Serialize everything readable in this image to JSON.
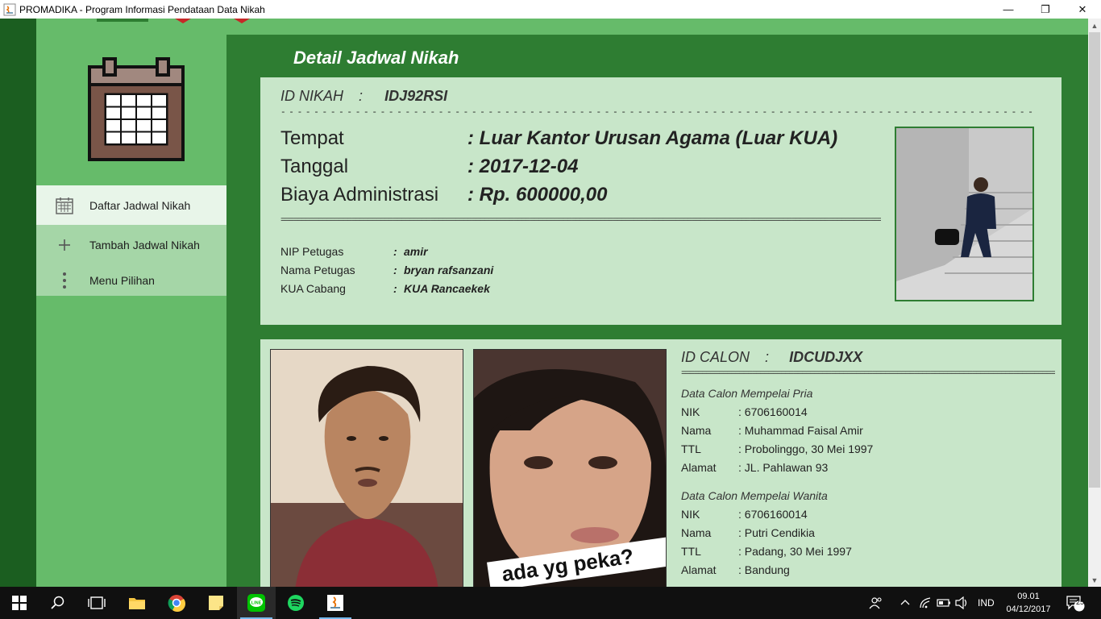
{
  "window": {
    "title": "PROMADIKA - Program Informasi Pendataan Data Nikah",
    "minimize": "—",
    "maximize": "❐",
    "close": "✕"
  },
  "sidebar": {
    "items": [
      {
        "label": "Daftar Jadwal Nikah",
        "icon": "calendar-icon",
        "active": true
      },
      {
        "label": "Tambah Jadwal Nikah",
        "icon": "plus-icon",
        "active": false
      },
      {
        "label": "Menu Pilihan",
        "icon": "more-vertical-icon",
        "active": false
      }
    ]
  },
  "main": {
    "title": "Detail Jadwal Nikah",
    "nikah": {
      "id_label": "ID NIKAH",
      "sep": ":",
      "id_value": "IDJ92RSI",
      "tempat_label": "Tempat",
      "tempat_value": ": Luar Kantor Urusan Agama (Luar KUA)",
      "tanggal_label": "Tanggal",
      "tanggal_value": ": 2017-12-04",
      "biaya_label": "Biaya Administrasi",
      "biaya_value": ": Rp. 600000,00",
      "nip_label": "NIP Petugas",
      "nip_value": "amir",
      "nama_petugas_label": "Nama Petugas",
      "nama_petugas_value": "bryan rafsanzani",
      "kua_label": "KUA Cabang",
      "kua_value": "KUA Rancaekek",
      "colon": ":"
    },
    "calon": {
      "id_label": "ID CALON",
      "sep": ":",
      "id_value": "IDCUDJXX",
      "pria_title": "Data Calon Mempelai Pria",
      "wanita_title": "Data Calon Mempelai Wanita",
      "labels": {
        "nik": "NIK",
        "nama": "Nama",
        "ttl": "TTL",
        "alamat": "Alamat"
      },
      "pria": {
        "nik": ": 6706160014",
        "nama": ": Muhammad Faisal Amir",
        "ttl": ": Probolinggo, 30 Mei 1997",
        "alamat": ": JL. Pahlawan 93"
      },
      "wanita": {
        "nik": ": 6706160014",
        "nama": ": Putri Cendikia",
        "ttl": ": Padang, 30 Mei 1997",
        "alamat": ": Bandung"
      },
      "bride_photo_caption": "ada yg peka?"
    }
  },
  "taskbar": {
    "language": "IND",
    "time": "09.01",
    "date": "04/12/2017",
    "notifications": "25"
  },
  "colors": {
    "dark_green": "#2e7d32",
    "sidebar_green": "#66bb6a",
    "card_green": "#c8e6c9",
    "active_item": "#e8f5e9"
  }
}
